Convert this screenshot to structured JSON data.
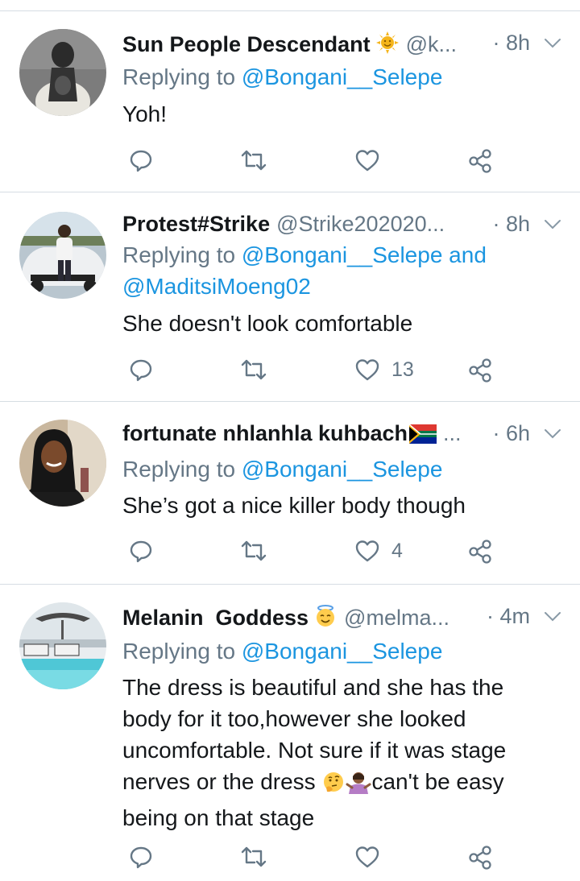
{
  "tweets": [
    {
      "name": "Sun People Descendant",
      "handle": "@k...",
      "time": "· 8h",
      "replying_prefix": "Replying to ",
      "replying_to": "@Bongani__Selepe",
      "replying_more": "",
      "body": "Yoh!",
      "likes": "",
      "name_emoji": "sun-face-emoji"
    },
    {
      "name": "Protest#Strike",
      "handle": "@Strike202020...",
      "time": "· 8h",
      "replying_prefix": "Replying to ",
      "replying_to": "@Bongani__Selepe",
      "replying_more": "and",
      "replying_to_2": "@MaditsiMoeng02",
      "body": "She doesn't look comfortable",
      "likes": "13"
    },
    {
      "name": "fortunate nhlanhla kuhbach",
      "handle": "...",
      "time": "· 6h",
      "replying_prefix": "Replying to ",
      "replying_to": "@Bongani__Selepe",
      "body": "She’s got a nice killer body though",
      "likes": "4",
      "name_emoji": "south-africa-flag-emoji"
    },
    {
      "name": "Melanin  Goddess",
      "handle": "@melma...",
      "time": "· 4m",
      "replying_prefix": "Replying to ",
      "replying_to": "@Bongani__Selepe",
      "body_lines": [
        "The dress is beautiful and she has the",
        "body for it too,however she looked",
        "uncomfortable. Not sure if it was stage",
        "nerves or the dress",
        "can't be easy",
        "being on that stage"
      ],
      "likes": "",
      "name_emoji": "smiling-face-with-halo-emoji"
    }
  ],
  "icons": {
    "reply": "reply-icon",
    "retweet": "retweet-icon",
    "like": "heart-icon",
    "share": "share-icon",
    "menu": "chevron-down-icon"
  },
  "colors": {
    "link": "#1b95e0",
    "secondary": "#657786",
    "divider": "#d6dde3"
  }
}
